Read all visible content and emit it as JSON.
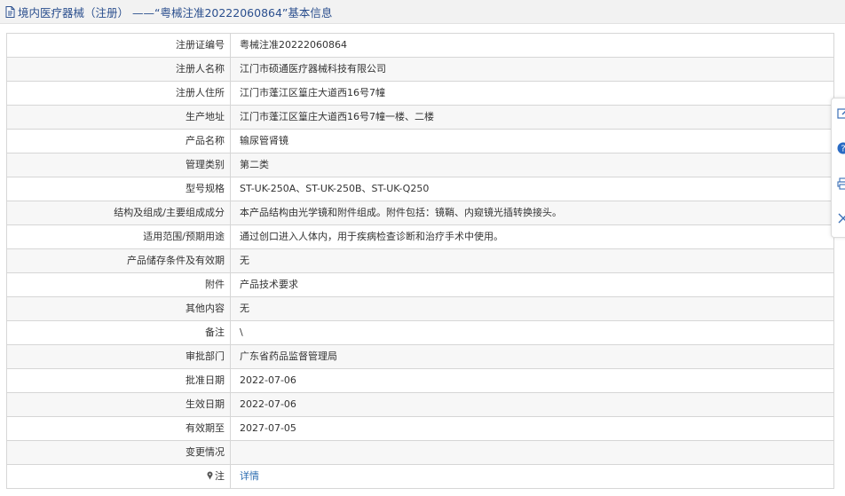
{
  "header": {
    "title": "境内医疗器械（注册） ——“粤械注准20222060864”基本信息",
    "icon": "document-icon"
  },
  "rows": [
    {
      "label": "注册证编号",
      "value": "粤械注准20222060864"
    },
    {
      "label": "注册人名称",
      "value": "江门市硕通医疗器械科技有限公司"
    },
    {
      "label": "注册人住所",
      "value": "江门市蓬江区篁庄大道西16号7幢"
    },
    {
      "label": "生产地址",
      "value": "江门市蓬江区篁庄大道西16号7幢一楼、二楼"
    },
    {
      "label": "产品名称",
      "value": "输尿管肾镜"
    },
    {
      "label": "管理类别",
      "value": "第二类"
    },
    {
      "label": "型号规格",
      "value": "ST-UK-250A、ST-UK-250B、ST-UK-Q250"
    },
    {
      "label": "结构及组成/主要组成成分",
      "value": "本产品结构由光学镜和附件组成。附件包括：镜鞘、内窥镜光插转换接头。"
    },
    {
      "label": "适用范围/预期用途",
      "value": "通过创口进入人体内，用于疾病检查诊断和治疗手术中使用。"
    },
    {
      "label": "产品储存条件及有效期",
      "value": "无"
    },
    {
      "label": "附件",
      "value": "产品技术要求"
    },
    {
      "label": "其他内容",
      "value": "无"
    },
    {
      "label": "备注",
      "value": "\\"
    },
    {
      "label": "审批部门",
      "value": "广东省药品监督管理局"
    },
    {
      "label": "批准日期",
      "value": "2022-07-06"
    },
    {
      "label": "生效日期",
      "value": "2022-07-06"
    },
    {
      "label": "有效期至",
      "value": "2027-07-05"
    },
    {
      "label": "变更情况",
      "value": ""
    },
    {
      "label": "注",
      "value": "详情",
      "label_icon": "pin-icon"
    }
  ],
  "side_tools": [
    "edit-icon",
    "help-icon",
    "print-icon",
    "close-icon"
  ],
  "colors": {
    "link": "#2b6cb0",
    "header_text": "#2b4f8e",
    "row_alt": "#f7f7f7",
    "border": "#d6d6d6"
  }
}
